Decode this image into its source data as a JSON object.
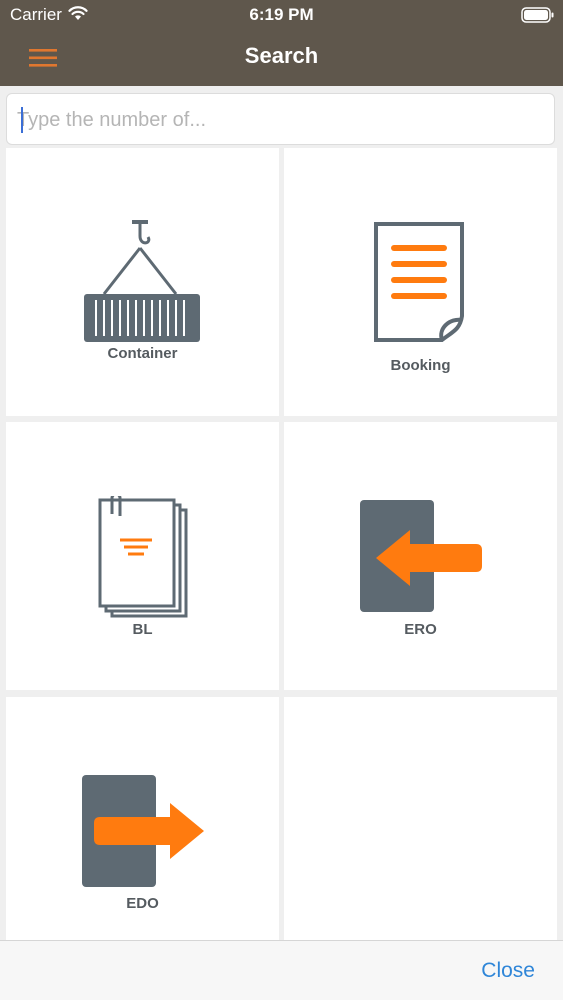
{
  "status_bar": {
    "carrier": "Carrier",
    "time": "6:19 PM"
  },
  "nav": {
    "title": "Search"
  },
  "search": {
    "placeholder": "Type the number of..."
  },
  "tiles": [
    {
      "label": "Container",
      "icon": "crane-container-icon"
    },
    {
      "label": "Booking",
      "icon": "document-icon"
    },
    {
      "label": "BL",
      "icon": "stacked-documents-icon"
    },
    {
      "label": "ERO",
      "icon": "arrow-in-door-icon"
    },
    {
      "label": "EDO",
      "icon": "arrow-out-door-icon"
    }
  ],
  "bottom_bar": {
    "close_label": "Close"
  },
  "colors": {
    "nav_bg": "#5f574c",
    "accent": "#ff7b0f",
    "icon_gray": "#5e6a73",
    "link": "#2f86d8"
  }
}
